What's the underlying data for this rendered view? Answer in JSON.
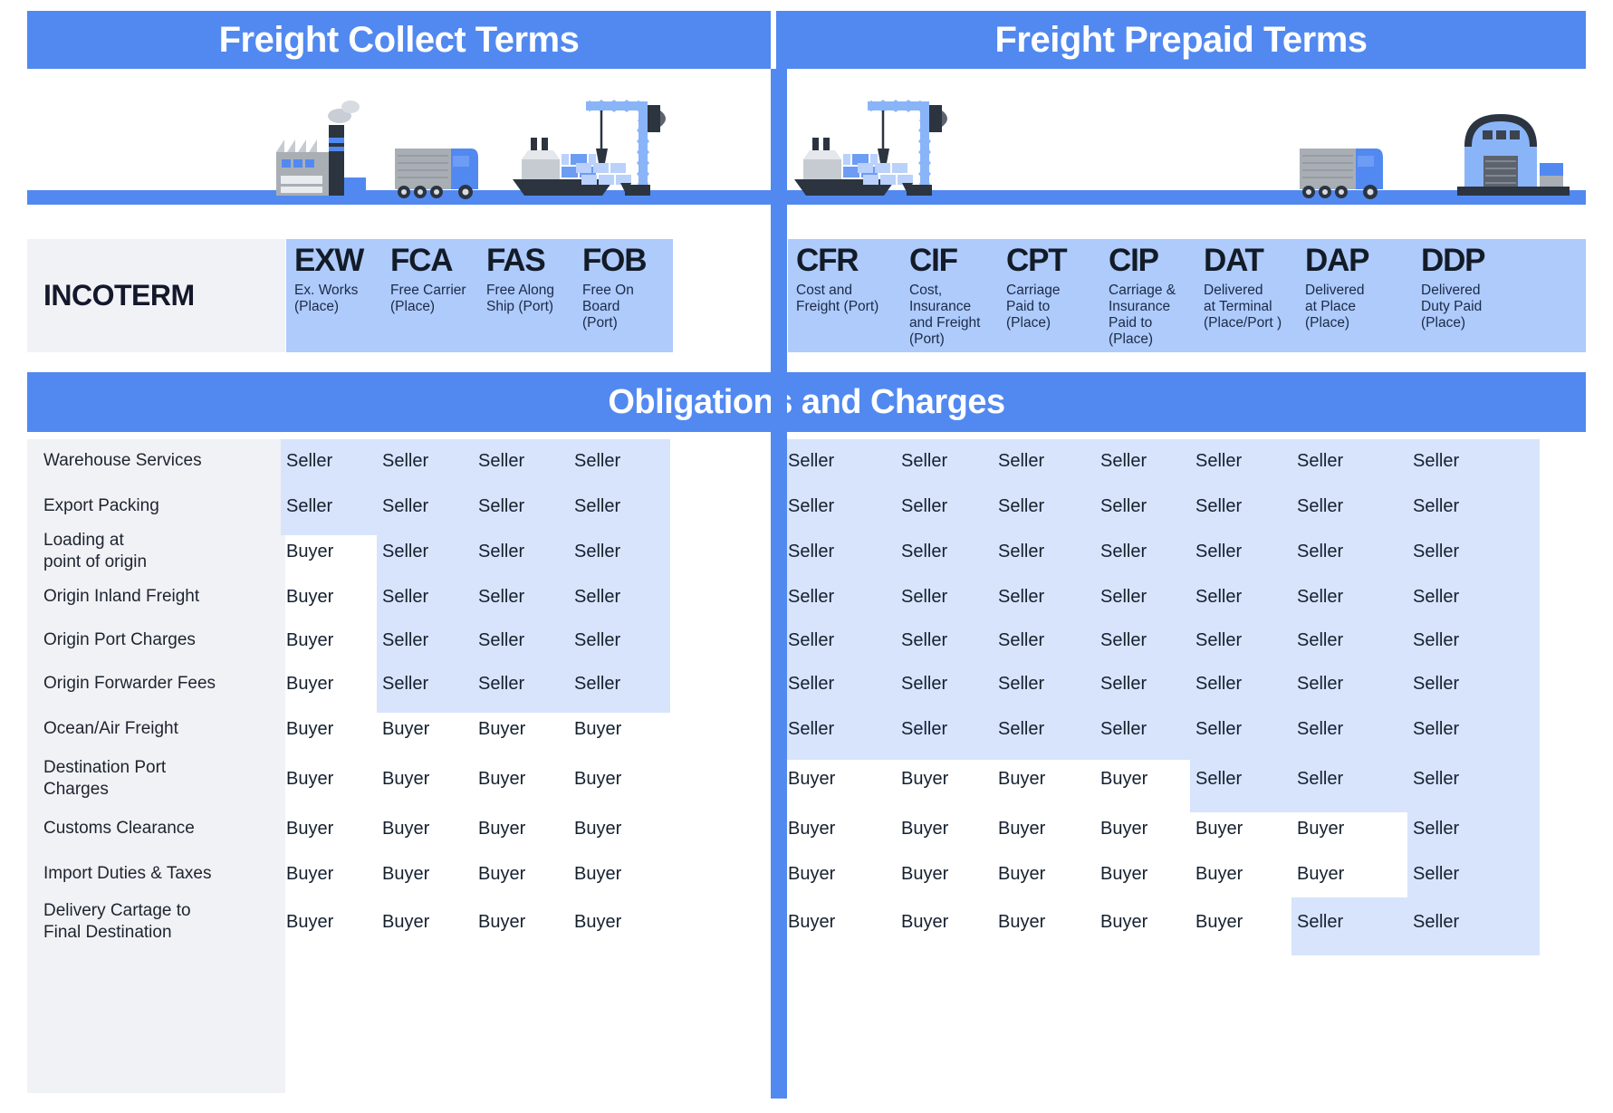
{
  "banners": {
    "collect": "Freight Collect Terms",
    "prepaid": "Freight Prepaid Terms",
    "obligations": "Obligations and Charges"
  },
  "incoterm_label": "INCOTERM",
  "illustrations": {
    "left": [
      "factory-icon",
      "truck-icon",
      "cargo-ship-icon",
      "port-crane-icon"
    ],
    "right": [
      "cargo-ship-icon",
      "port-crane-icon",
      "truck-icon",
      "warehouse-icon"
    ]
  },
  "colors": {
    "banner_blue": "#5289f0",
    "header_blue": "#aecbfc",
    "cell_blue": "#d7e4fc",
    "rowlabel_grey": "#f1f2f5",
    "white": "#ffffff"
  },
  "terms": [
    {
      "code": "EXW",
      "sub": "Ex. Works\n(Place)",
      "group": "collect"
    },
    {
      "code": "FCA",
      "sub": "Free Carrier\n(Place)",
      "group": "collect"
    },
    {
      "code": "FAS",
      "sub": "Free Along\nShip (Port)",
      "group": "collect"
    },
    {
      "code": "FOB",
      "sub": "Free On Board\n(Port)",
      "group": "collect"
    },
    {
      "code": "CFR",
      "sub": "Cost and\nFreight (Port)",
      "group": "prepaid"
    },
    {
      "code": "CIF",
      "sub": "Cost,\nInsurance\nand Freight\n(Port)",
      "group": "prepaid"
    },
    {
      "code": "CPT",
      "sub": "Carriage\nPaid to\n(Place)",
      "group": "prepaid"
    },
    {
      "code": "CIP",
      "sub": "Carriage &\nInsurance\nPaid to\n(Place)",
      "group": "prepaid"
    },
    {
      "code": "DAT",
      "sub": "Delivered\nat Terminal\n(Place/Port )",
      "group": "prepaid"
    },
    {
      "code": "DAP",
      "sub": "Delivered\nat Place\n(Place)",
      "group": "prepaid"
    },
    {
      "code": "DDP",
      "sub": "Delivered\nDuty Paid\n(Place)",
      "group": "prepaid"
    }
  ],
  "rows": [
    {
      "label": "Warehouse Services",
      "values": [
        "Seller",
        "Seller",
        "Seller",
        "Seller",
        "Seller",
        "Seller",
        "Seller",
        "Seller",
        "Seller",
        "Seller",
        "Seller"
      ]
    },
    {
      "label": "Export Packing",
      "values": [
        "Seller",
        "Seller",
        "Seller",
        "Seller",
        "Seller",
        "Seller",
        "Seller",
        "Seller",
        "Seller",
        "Seller",
        "Seller"
      ]
    },
    {
      "label": "Loading at\npoint of origin",
      "values": [
        "Buyer",
        "Seller",
        "Seller",
        "Seller",
        "Seller",
        "Seller",
        "Seller",
        "Seller",
        "Seller",
        "Seller",
        "Seller"
      ]
    },
    {
      "label": "Origin Inland Freight",
      "values": [
        "Buyer",
        "Seller",
        "Seller",
        "Seller",
        "Seller",
        "Seller",
        "Seller",
        "Seller",
        "Seller",
        "Seller",
        "Seller"
      ]
    },
    {
      "label": "Origin Port Charges",
      "values": [
        "Buyer",
        "Seller",
        "Seller",
        "Seller",
        "Seller",
        "Seller",
        "Seller",
        "Seller",
        "Seller",
        "Seller",
        "Seller"
      ]
    },
    {
      "label": "Origin Forwarder Fees",
      "values": [
        "Buyer",
        "Seller",
        "Seller",
        "Seller",
        "Seller",
        "Seller",
        "Seller",
        "Seller",
        "Seller",
        "Seller",
        "Seller"
      ]
    },
    {
      "label": "Ocean/Air Freight",
      "values": [
        "Buyer",
        "Buyer",
        "Buyer",
        "Buyer",
        "Seller",
        "Seller",
        "Seller",
        "Seller",
        "Seller",
        "Seller",
        "Seller"
      ]
    },
    {
      "label": "Destination Port\nCharges",
      "values": [
        "Buyer",
        "Buyer",
        "Buyer",
        "Buyer",
        "Buyer",
        "Buyer",
        "Buyer",
        "Buyer",
        "Seller",
        "Seller",
        "Seller"
      ]
    },
    {
      "label": "Customs Clearance",
      "values": [
        "Buyer",
        "Buyer",
        "Buyer",
        "Buyer",
        "Buyer",
        "Buyer",
        "Buyer",
        "Buyer",
        "Buyer",
        "Buyer",
        "Seller"
      ]
    },
    {
      "label": "Import Duties & Taxes",
      "values": [
        "Buyer",
        "Buyer",
        "Buyer",
        "Buyer",
        "Buyer",
        "Buyer",
        "Buyer",
        "Buyer",
        "Buyer",
        "Buyer",
        "Seller"
      ]
    },
    {
      "label": "Delivery Cartage to\nFinal Destination",
      "values": [
        "Buyer",
        "Buyer",
        "Buyer",
        "Buyer",
        "Buyer",
        "Buyer",
        "Buyer",
        "Buyer",
        "Buyer",
        "Seller",
        "Seller"
      ]
    }
  ]
}
